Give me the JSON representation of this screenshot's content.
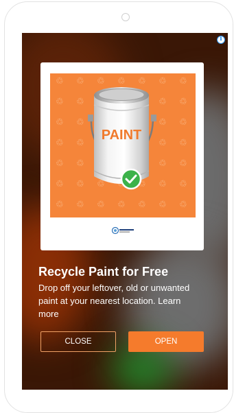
{
  "ad": {
    "choices_icon": "info-icon",
    "creative": {
      "can_label": "PAINT",
      "pattern_icon": "recycle-icon",
      "badge_icon": "checkmark-icon",
      "brand": "productcare RECYCLING"
    },
    "headline": "Recycle Paint for Free",
    "body": "Drop off your leftover, old or unwanted paint at your nearest location. Learn more",
    "close_label": "CLOSE",
    "open_label": "OPEN"
  },
  "colors": {
    "accent_orange": "#f57b2c",
    "creative_bg": "#f5853a",
    "check_green": "#3cb24a",
    "ad_choices_blue": "#2a8ce4"
  }
}
